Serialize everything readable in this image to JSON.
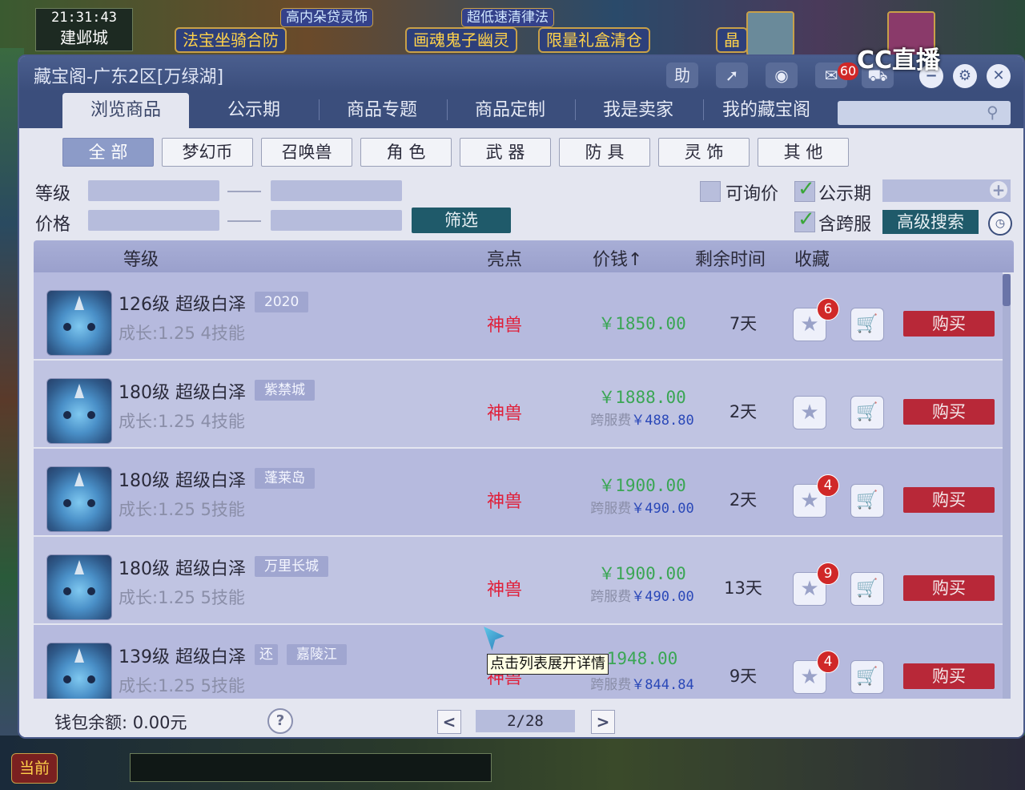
{
  "game": {
    "time": "21:31:43",
    "city": "建邺城",
    "news_top": [
      "高内朵贷灵饰",
      "超低速清律法"
    ],
    "news_bottom": [
      "法宝坐骑合防",
      "画魂鬼子幽灵",
      "限量礼盒清仓"
    ],
    "gem_label": "晶",
    "current_label": "当前",
    "stream_logo": "CC直播"
  },
  "window": {
    "title": "藏宝阁-广东2区[万绿湖]",
    "help_label": "助",
    "message_count": "60"
  },
  "tabs": [
    "浏览商品",
    "公示期",
    "商品专题",
    "商品定制",
    "我是卖家",
    "我的藏宝阁"
  ],
  "categories": [
    "全 部",
    "梦幻币",
    "召唤兽",
    "角 色",
    "武 器",
    "防 具",
    "灵 饰",
    "其 他"
  ],
  "filters": {
    "level_label": "等级",
    "price_label": "价格",
    "filter_button": "筛选",
    "negotiable_label": "可询价",
    "public_period_label": "公示期",
    "cross_server_label": "含跨服",
    "advanced_search": "高级搜索"
  },
  "table": {
    "headers": {
      "level": "等级",
      "highlight": "亮点",
      "price": "价钱",
      "remaining": "剩余时间",
      "favorite": "收藏"
    },
    "rows": [
      {
        "name": "126级  超级白泽",
        "tags": [
          "2020"
        ],
        "growth": "成长:1.25  4技能",
        "highlight": "神兽",
        "price": "￥1850.00",
        "cross_label": "",
        "cross_fee": "",
        "remaining": "7天",
        "fav_count": "6",
        "buy": "购买"
      },
      {
        "name": "180级  超级白泽",
        "tags": [
          "紫禁城"
        ],
        "growth": "成长:1.25  4技能",
        "highlight": "神兽",
        "price": "￥1888.00",
        "cross_label": "跨服费",
        "cross_fee": "￥488.80",
        "remaining": "2天",
        "fav_count": "",
        "buy": "购买"
      },
      {
        "name": "180级  超级白泽",
        "tags": [
          "蓬莱岛"
        ],
        "growth": "成长:1.25  5技能",
        "highlight": "神兽",
        "price": "￥1900.00",
        "cross_label": "跨服费",
        "cross_fee": "￥490.00",
        "remaining": "2天",
        "fav_count": "4",
        "buy": "购买"
      },
      {
        "name": "180级  超级白泽",
        "tags": [
          "万里长城"
        ],
        "growth": "成长:1.25  5技能",
        "highlight": "神兽",
        "price": "￥1900.00",
        "cross_label": "跨服费",
        "cross_fee": "￥490.00",
        "remaining": "13天",
        "fav_count": "9",
        "buy": "购买"
      },
      {
        "name": "139级  超级白泽",
        "tags": [
          "还",
          "嘉陵江"
        ],
        "growth": "成长:1.25  5技能",
        "highlight": "神兽",
        "price": "1948.00",
        "cross_label": "跨服费",
        "cross_fee": "￥844.84",
        "remaining": "9天",
        "fav_count": "4",
        "buy": "购买"
      }
    ]
  },
  "tooltip": "点击列表展开详情",
  "footer": {
    "wallet": "钱包余额: 0.00元",
    "page": "2/28"
  }
}
